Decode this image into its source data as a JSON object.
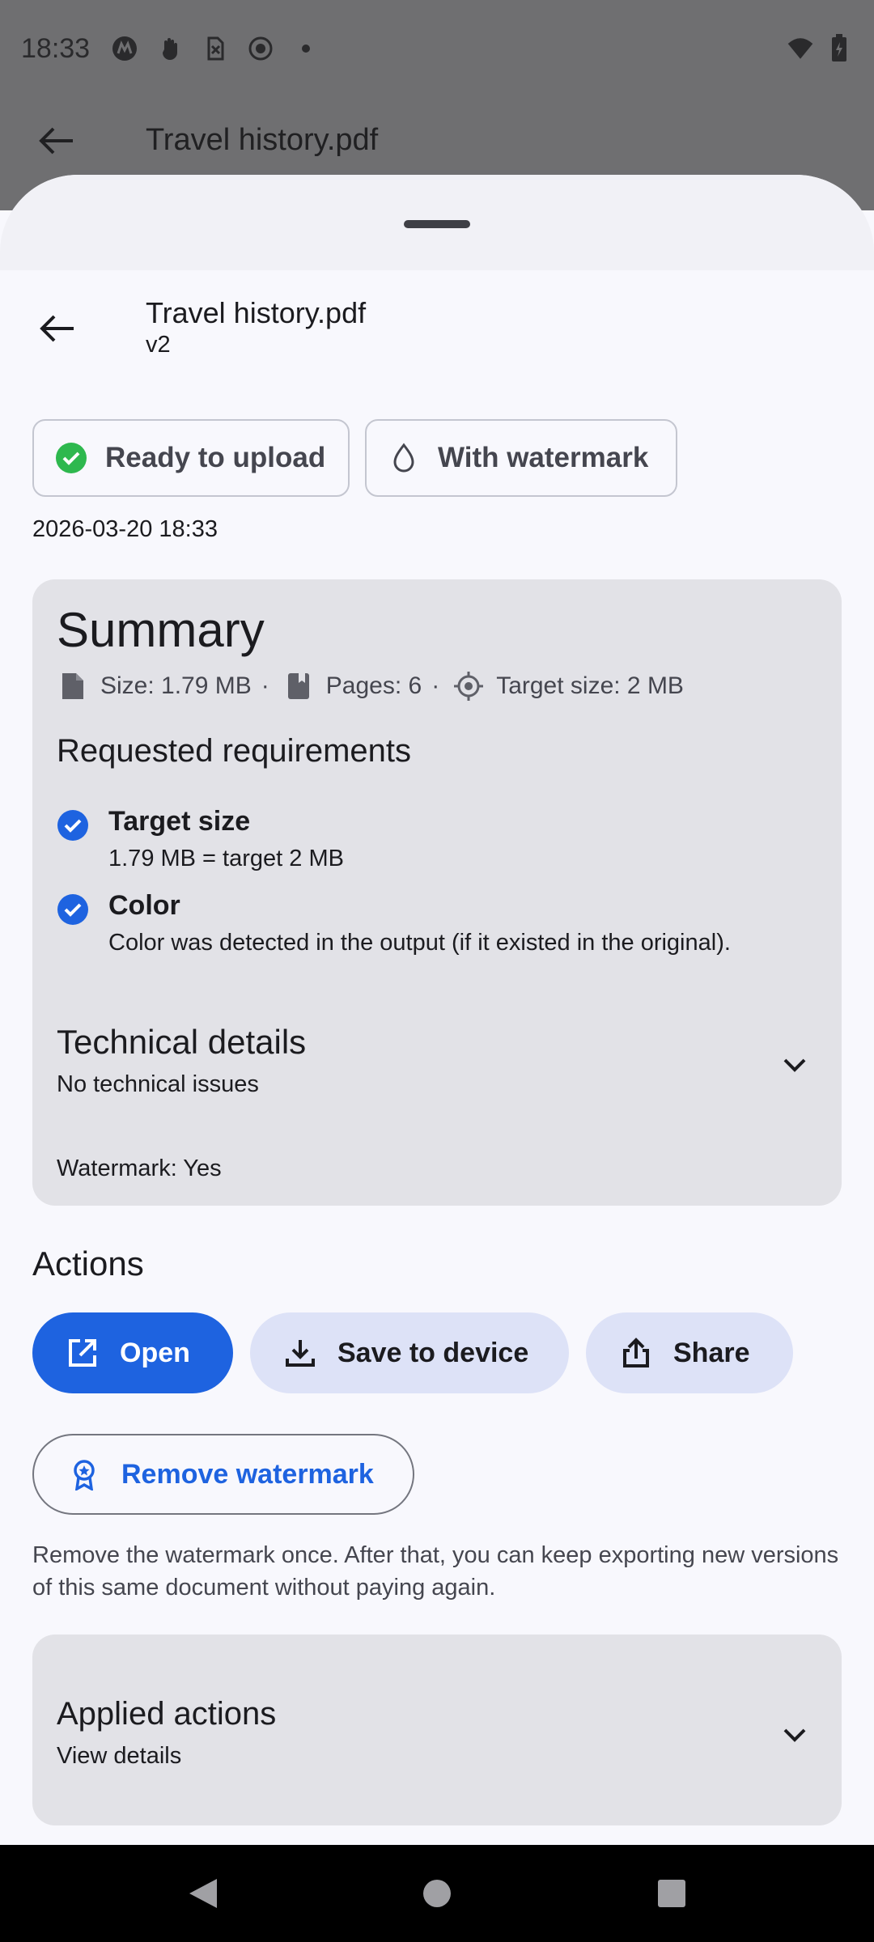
{
  "status_bar": {
    "time": "18:33"
  },
  "background_app": {
    "title": "Travel history.pdf"
  },
  "header": {
    "title": "Travel history.pdf",
    "version": "v2"
  },
  "chips": [
    {
      "label": "Ready to upload",
      "icon": "check-circle-icon",
      "color": "#2eb84e"
    },
    {
      "label": "With watermark",
      "icon": "water-drop-icon"
    }
  ],
  "timestamp": "2026-03-20 18:33",
  "summary": {
    "title": "Summary",
    "size": "Size: 1.79 MB",
    "pages": "Pages: 6",
    "target": "Target size: 2 MB",
    "separator": "·",
    "requirements_title": "Requested requirements",
    "requirements": [
      {
        "label": "Target size",
        "desc": "1.79 MB = target 2 MB"
      },
      {
        "label": "Color",
        "desc": "Color was detected in the output (if it existed in the original)."
      }
    ],
    "technical_title": "Technical details",
    "technical_sub": "No technical issues",
    "watermark_line": "Watermark: Yes"
  },
  "actions": {
    "title": "Actions",
    "open": "Open",
    "save": "Save to device",
    "share": "Share",
    "remove_watermark": "Remove watermark",
    "remove_desc": "Remove the watermark once. After that, you can keep exporting new versions of this same document without paying again."
  },
  "applied": {
    "title": "Applied actions",
    "sub": "View details"
  },
  "colors": {
    "accent": "#1e63e0",
    "tonal": "#dde2f7",
    "card": "#e2e2e7",
    "success": "#2eb84e"
  }
}
